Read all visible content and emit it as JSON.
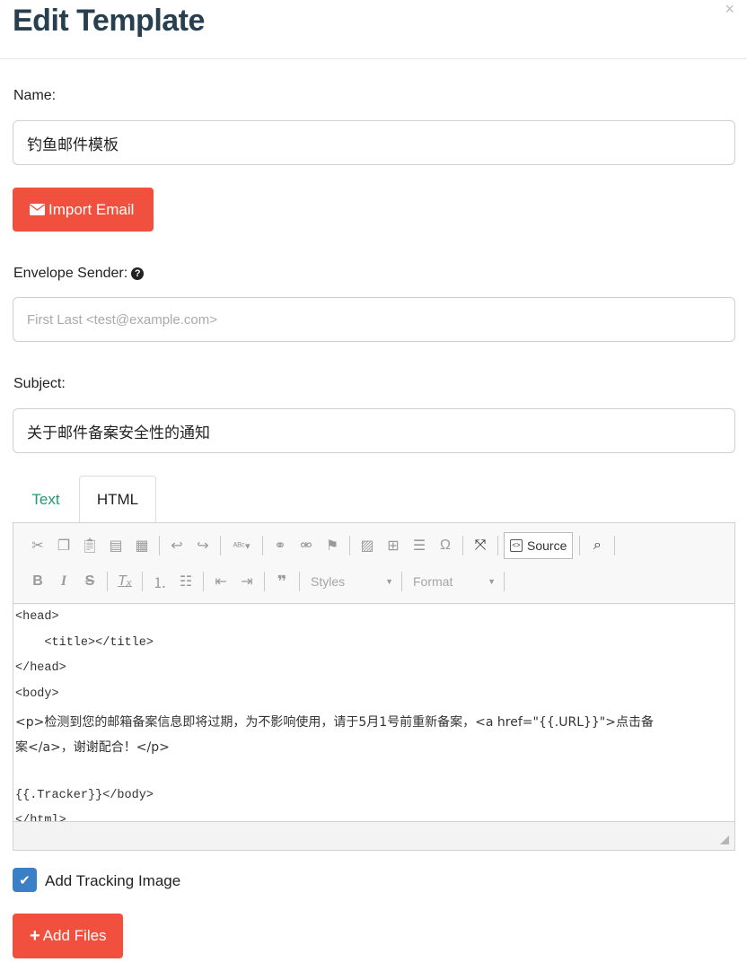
{
  "modal": {
    "title": "Edit Template",
    "close_label": "×"
  },
  "name": {
    "label": "Name:",
    "value": "钓鱼邮件模板"
  },
  "import_button": {
    "label": "Import Email",
    "icon": "envelope-icon"
  },
  "envelope_sender": {
    "label": "Envelope Sender:",
    "help_icon": "?",
    "placeholder": "First Last <test@example.com>"
  },
  "subject": {
    "label": "Subject:",
    "value": "关于邮件备案安全性的通知"
  },
  "tabs": [
    {
      "label": "Text",
      "active": false
    },
    {
      "label": "HTML",
      "active": true
    }
  ],
  "editor": {
    "source_label": "Source",
    "styles_label": "Styles",
    "format_label": "Format",
    "code_lines": [
      "<head>",
      "    <title></title>",
      "</head>",
      "<body>",
      "<p>检测到您的邮箱备案信息即将过期，为不影响使用，请于5月1号前重新备案，<a href=\"{{.URL}}\">点击备",
      "案</a>，谢谢配合！</p>",
      "",
      "{{.Tracker}}</body>",
      "</html>"
    ]
  },
  "tracking": {
    "label": "Add Tracking Image",
    "checked": true
  },
  "add_files_button": {
    "label": "Add Files",
    "icon": "plus-icon"
  },
  "colors": {
    "accent_red": "#f1503f",
    "tab_green": "#1f9a72",
    "checkbox_blue": "#3b7fc6",
    "title_color": "#283f50"
  }
}
